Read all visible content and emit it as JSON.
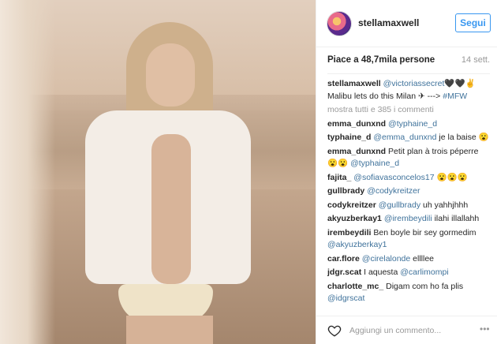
{
  "post": {
    "username": "stellamaxwell",
    "follow_label": "Segui",
    "likes_text": "Piace a 48,7mila persone",
    "time_text": "14 sett."
  },
  "caption": {
    "user": "stellamaxwell",
    "mention": "@victoriassecret",
    "emoji": "🖤🖤✌",
    "text": "Malibu lets do this Milan ✈ ---> ",
    "hashtag": "#MFW"
  },
  "view_all_comments": "mostra tutti e 385 i commenti",
  "comments": [
    {
      "user": "emma_dunxnd",
      "mention": "@typhaine_d",
      "text": ""
    },
    {
      "user": "typhaine_d",
      "mention": "@emma_dunxnd",
      "text": " je la baise 😮"
    },
    {
      "user": "emma_dunxnd",
      "mention": "",
      "text": "Petit plan à trois péperre 😮😮 ",
      "mention2": "@typhaine_d"
    },
    {
      "user": "fajita_",
      "mention": "@sofiavasconcelos17",
      "text": " 😮😮😮"
    },
    {
      "user": "gullbrady",
      "mention": "@codykreitzer",
      "text": ""
    },
    {
      "user": "codykreitzer",
      "mention": "@gullbrady",
      "text": " uh yahhjhhh"
    },
    {
      "user": "akyuzberkay1",
      "mention": "@irembeydili",
      "text": " ilahi illallahh"
    },
    {
      "user": "irembeydili",
      "mention": "",
      "text": "Ben boyle bir sey gormedim ",
      "mention2": "@akyuzberkay1"
    },
    {
      "user": "car.flore",
      "mention": "@cirelalonde",
      "text": " ellllee"
    },
    {
      "user": "jdgr.scat",
      "mention": "",
      "text": "I aquesta ",
      "mention2": "@carlimompi"
    },
    {
      "user": "charlotte_mc_",
      "mention": "",
      "text": "Digam com ho fa plis ",
      "mention2": "@idgrscat"
    }
  ],
  "comment_input": {
    "placeholder": "Aggiungi un commento..."
  },
  "icons": {
    "like": "heart-icon",
    "more": "more-options-icon"
  },
  "colors": {
    "accent": "#3897f0",
    "link": "#3f729b",
    "muted": "#999999"
  }
}
